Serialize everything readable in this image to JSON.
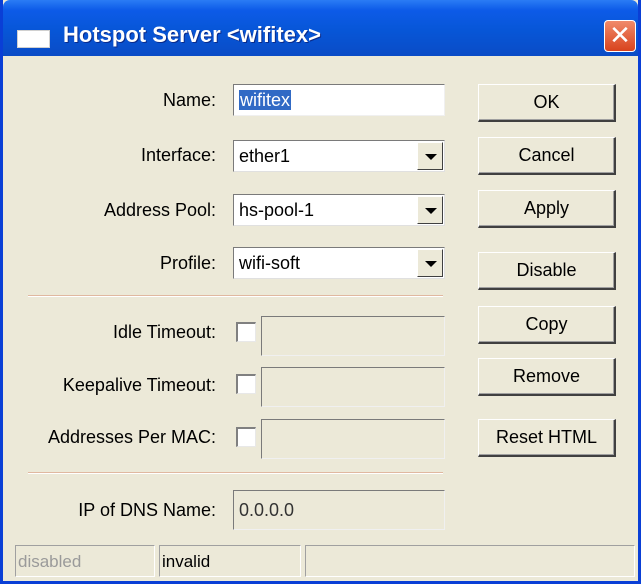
{
  "window": {
    "title": "Hotspot Server <wifitex>",
    "close_glyph": "✕"
  },
  "form": {
    "name": {
      "label": "Name:",
      "value": "wifitex"
    },
    "interface": {
      "label": "Interface:",
      "value": "ether1"
    },
    "address_pool": {
      "label": "Address Pool:",
      "value": "hs-pool-1"
    },
    "profile": {
      "label": "Profile:",
      "value": "wifi-soft"
    },
    "idle_timeout": {
      "label": "Idle Timeout:",
      "checked": false,
      "value": ""
    },
    "keepalive_timeout": {
      "label": "Keepalive Timeout:",
      "checked": false,
      "value": ""
    },
    "addresses_per_mac": {
      "label": "Addresses Per MAC:",
      "checked": false,
      "value": ""
    },
    "ip_of_dns_name": {
      "label": "IP of DNS Name:",
      "value": "0.0.0.0"
    }
  },
  "buttons": {
    "ok": "OK",
    "cancel": "Cancel",
    "apply": "Apply",
    "disable": "Disable",
    "copy": "Copy",
    "remove": "Remove",
    "reset_html": "Reset HTML"
  },
  "status_bar": {
    "state": "disabled",
    "validity": "invalid",
    "extra": ""
  },
  "colors": {
    "titlebar": "#0756d7",
    "window_bg": "#ece9d8",
    "selection": "#316ac5",
    "close_button": "#d8431d"
  },
  "icons": {
    "window_icon": "window-icon",
    "close": "close-icon",
    "dropdown": "chevron-down-icon"
  }
}
